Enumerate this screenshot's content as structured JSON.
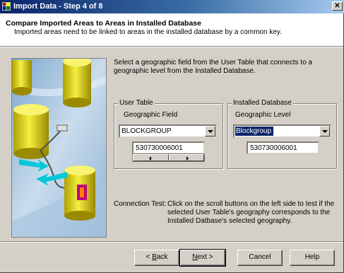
{
  "window": {
    "title": "Import Data - Step 4 of 8",
    "close_glyph": "✕"
  },
  "header": {
    "title": "Compare Imported Areas to Areas in Installed Database",
    "subtitle": "Imported areas need to be linked to areas in the installed database by a common key."
  },
  "instructions": "Select a geographic field from the User Table that connects to a geographic level from the Installed Database.",
  "user_table": {
    "group_label": "User Table",
    "field_label": "Geographic Field",
    "field_value": "BLOCKGROUP",
    "sample_value": "530730006001"
  },
  "installed_db": {
    "group_label": "Installed Database",
    "level_label": "Geographic Level",
    "level_value": "Blockgroup",
    "sample_value": "530730006001"
  },
  "connection_test": {
    "label": "Connection Test:",
    "text": "Click on the scroll buttons on the left side to test if the selected User Table's geography corresponds to the Installed Datbase's selected geography."
  },
  "buttons": {
    "back": {
      "prefix": "< ",
      "mnemonic": "B",
      "rest": "ack"
    },
    "next": {
      "mnemonic": "N",
      "rest": "ext >"
    },
    "cancel": "Cancel",
    "help": "Help"
  },
  "icons": {
    "app": "database-import-icon",
    "illustration": "database-cylinders-illustration"
  },
  "colors": {
    "title_bar": "#0a246a",
    "selection": "#0a246a",
    "dialog_face": "#d4d0c8"
  }
}
